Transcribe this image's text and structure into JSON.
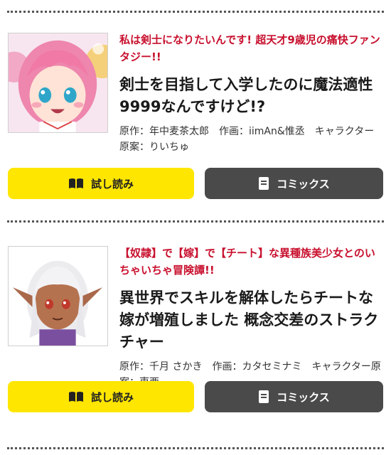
{
  "entries": [
    {
      "tagline": "私は剣士になりたいんです! 超天才9歳児の痛快ファンタジー!!",
      "title": "剣士を目指して入学したのに魔法適性9999なんですけど!?",
      "credits": "原作：年中麦茶太郎　作画：iimAn&惟丞　キャラクター原案：りいちゅ",
      "cover_icon": "manga-cover-pink-haired-girl",
      "read_label": "試し読み",
      "comics_label": "コミックス"
    },
    {
      "tagline": "【奴隷】で【嫁】で【チート】な異種族美少女とのいちゃいちゃ冒険譚!!",
      "title": "異世界でスキルを解体したらチートな嫁が増殖しました 概念交差のストラクチャー",
      "credits": "原作：千月 さかき　作画：カタセミナミ　キャラクター原案：東西",
      "cover_icon": "manga-cover-elf-girl",
      "read_label": "試し読み",
      "comics_label": "コミックス"
    }
  ],
  "colors": {
    "tagline": "#c8102e",
    "read_button": "#ffe600",
    "comics_button": "#4a4a4a"
  },
  "icons": {
    "read": "open-book-icon",
    "comics": "document-icon"
  }
}
